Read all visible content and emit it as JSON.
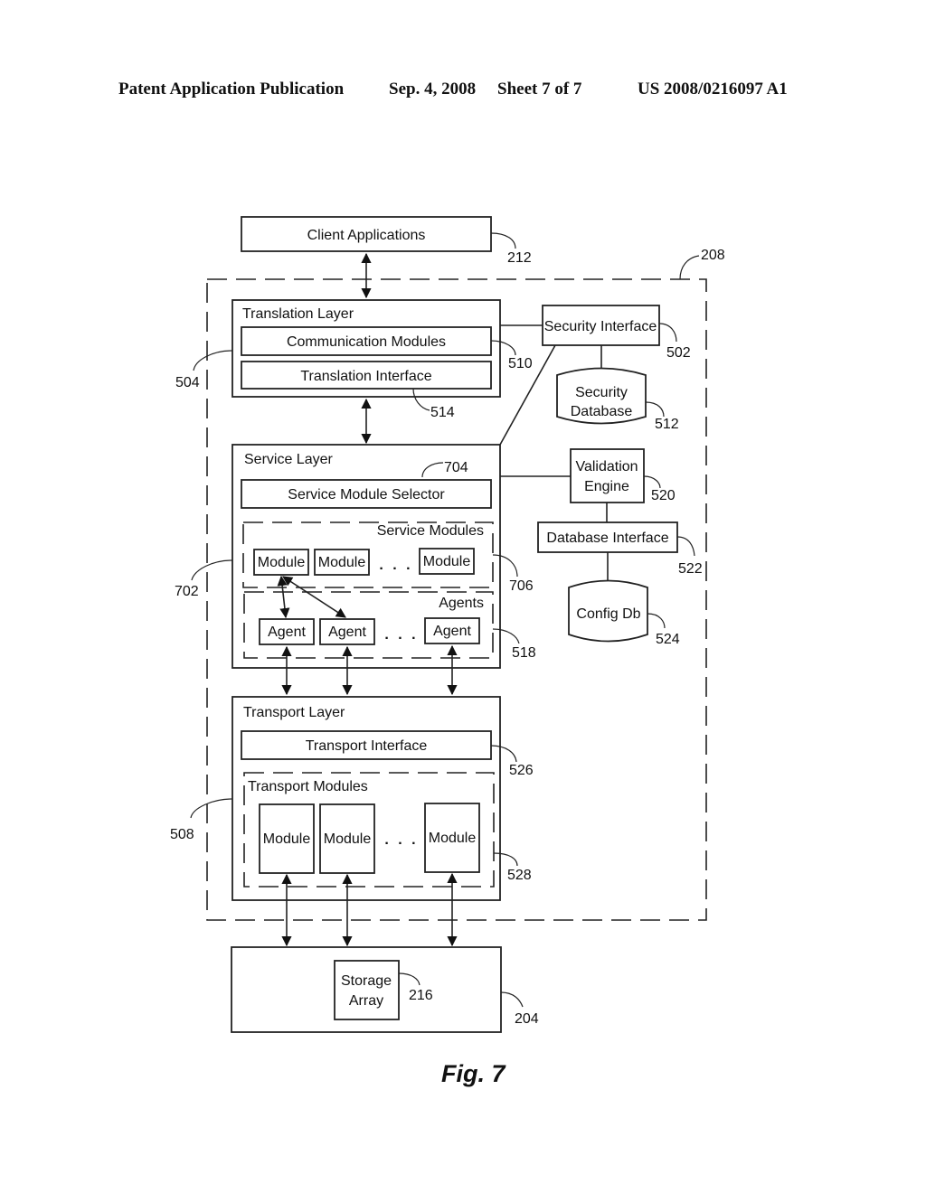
{
  "header": {
    "publication": "Patent Application Publication",
    "date": "Sep. 4, 2008",
    "sheet": "Sheet 7 of 7",
    "number": "US 2008/0216097 A1"
  },
  "figure_label": "Fig. 7",
  "nodes": {
    "client_applications": {
      "label": "Client Applications",
      "ref": "212"
    },
    "system_boundary": {
      "ref": "208"
    },
    "translation_layer": {
      "label": "Translation Layer",
      "ref": "504"
    },
    "communication_modules": {
      "label": "Communication Modules",
      "ref": "510"
    },
    "translation_interface": {
      "label": "Translation Interface",
      "ref": "514"
    },
    "security_interface": {
      "label": "Security Interface",
      "ref": "502"
    },
    "security_database": {
      "label_line1": "Security",
      "label_line2": "Database",
      "ref": "512"
    },
    "service_layer": {
      "label": "Service Layer",
      "ref": "702"
    },
    "service_module_selector": {
      "label": "Service Module Selector",
      "ref": "704"
    },
    "service_modules": {
      "label": "Service Modules",
      "ref": "706",
      "items": [
        "Module",
        "Module",
        "Module"
      ],
      "ellipsis": ". . ."
    },
    "agents": {
      "label": "Agents",
      "ref": "518",
      "items": [
        "Agent",
        "Agent",
        "Agent"
      ],
      "ellipsis": ". . ."
    },
    "validation_engine": {
      "label_line1": "Validation",
      "label_line2": "Engine",
      "ref": "520"
    },
    "database_interface": {
      "label": "Database Interface",
      "ref": "522"
    },
    "config_db": {
      "label": "Config Db",
      "ref": "524"
    },
    "transport_layer": {
      "label": "Transport Layer",
      "ref": "508"
    },
    "transport_interface": {
      "label": "Transport Interface",
      "ref": "526"
    },
    "transport_modules": {
      "label": "Transport Modules",
      "ref": "528",
      "items": [
        "Module",
        "Module",
        "Module"
      ],
      "ellipsis": ". . ."
    },
    "storage_system": {
      "ref": "204"
    },
    "storage_array": {
      "label_line1": "Storage",
      "label_line2": "Array",
      "ref": "216"
    }
  }
}
